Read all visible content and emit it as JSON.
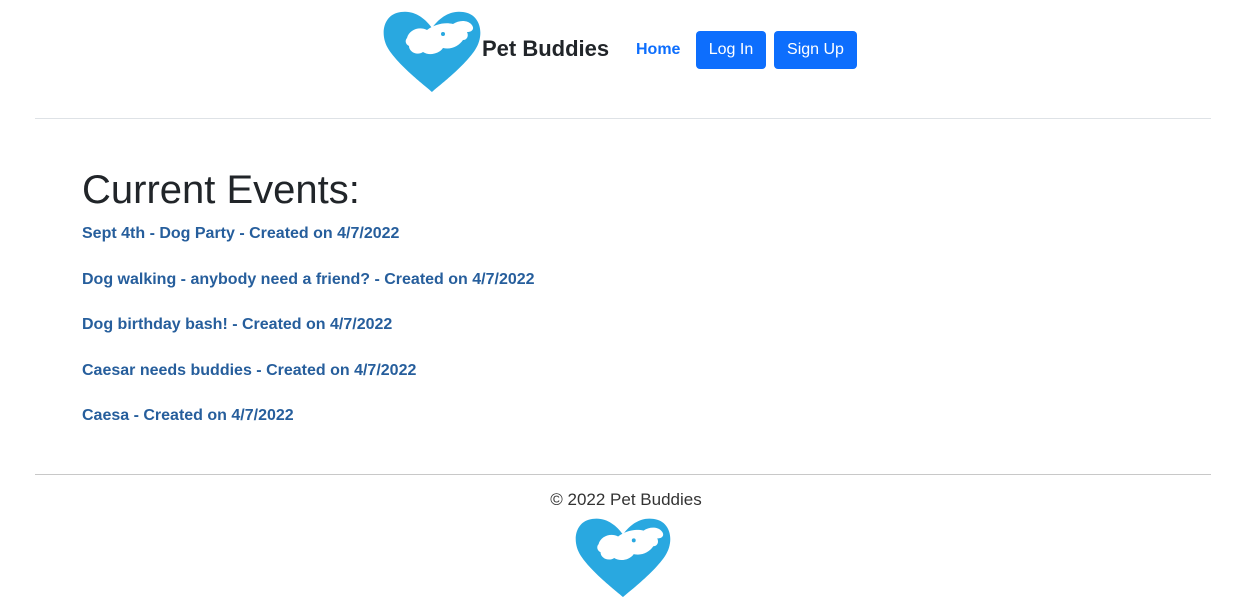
{
  "header": {
    "brand": "Pet Buddies",
    "logo_icon": "heart-dog-logo",
    "nav": {
      "home_label": "Home",
      "login_label": "Log In",
      "signup_label": "Sign Up"
    }
  },
  "main": {
    "title": "Current Events:",
    "events": [
      "Sept 4th - Dog Party - Created on 4/7/2022",
      "Dog walking - anybody need a friend? - Created on 4/7/2022",
      "Dog birthday bash! - Created on 4/7/2022",
      "Caesar needs buddies - Created on 4/7/2022",
      "Caesa - Created on 4/7/2022"
    ]
  },
  "footer": {
    "copyright": "© 2022 Pet Buddies"
  },
  "colors": {
    "logo_blue": "#29a8e0",
    "button_blue": "#0d6efd",
    "event_link": "#265e9c"
  }
}
